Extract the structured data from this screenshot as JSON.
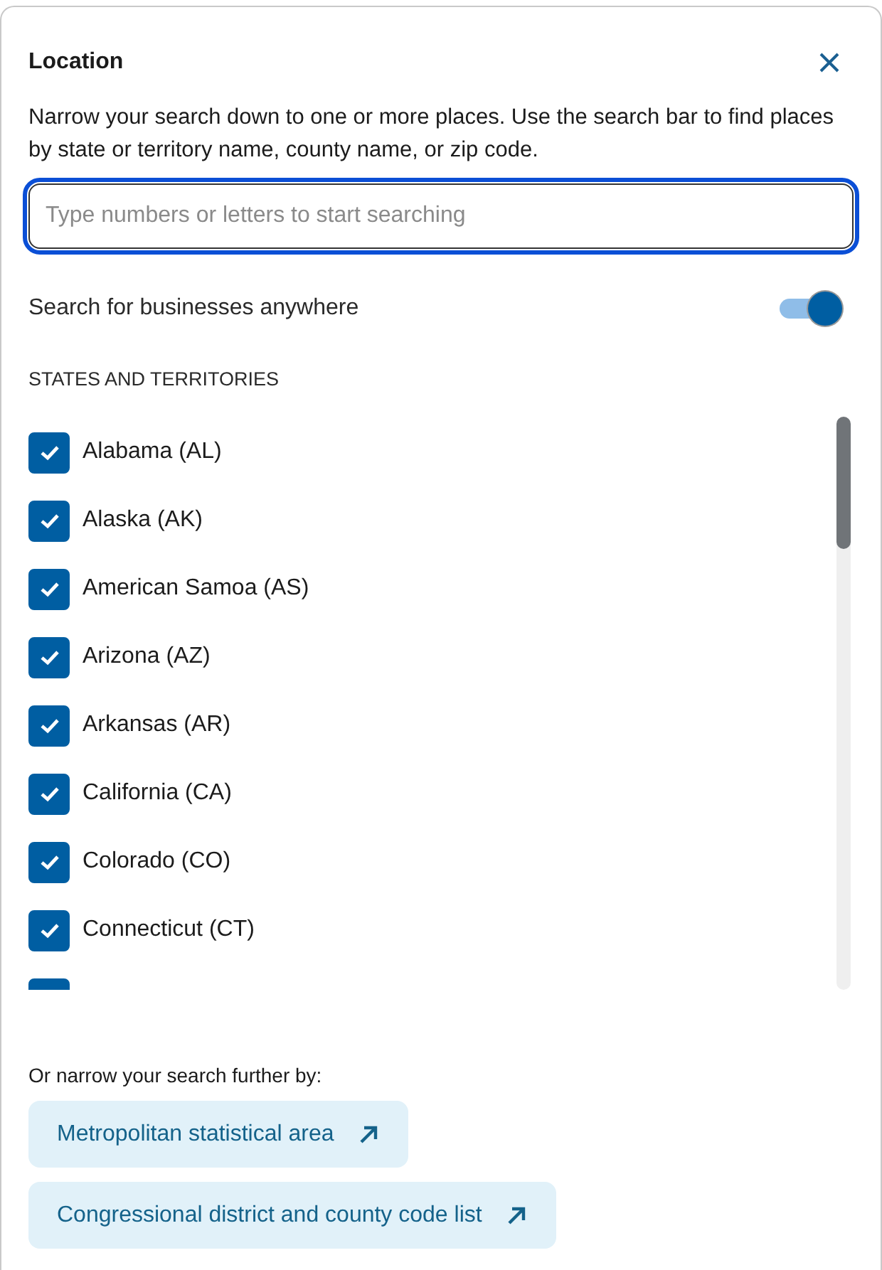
{
  "dialog": {
    "title": "Location",
    "description": "Narrow your search down to one or more places. Use the search bar to find places by state or territory name, county name, or zip code."
  },
  "search": {
    "placeholder": "Type numbers or letters to start searching"
  },
  "toggle": {
    "label": "Search for businesses anywhere",
    "on": true
  },
  "section_heading": "STATES AND TERRITORIES",
  "states": [
    {
      "label": "Alabama (AL)",
      "checked": true
    },
    {
      "label": "Alaska (AK)",
      "checked": true
    },
    {
      "label": "American Samoa (AS)",
      "checked": true
    },
    {
      "label": "Arizona (AZ)",
      "checked": true
    },
    {
      "label": "Arkansas (AR)",
      "checked": true
    },
    {
      "label": "California (CA)",
      "checked": true
    },
    {
      "label": "Colorado (CO)",
      "checked": true
    },
    {
      "label": "Connecticut (CT)",
      "checked": true
    },
    {
      "checked": true
    }
  ],
  "footer": {
    "text": "Or narrow your search further by:",
    "links": [
      "Metropolitan statistical area",
      "Congressional district and county code list"
    ]
  }
}
